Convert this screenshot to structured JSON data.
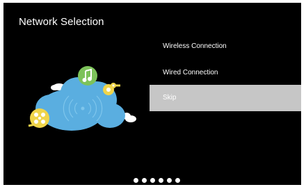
{
  "screen": {
    "title": "Network Selection"
  },
  "menu": {
    "items": [
      {
        "label": "Wireless Connection",
        "selected": false
      },
      {
        "label": "Wired Connection",
        "selected": false
      },
      {
        "label": "Skip",
        "selected": true
      }
    ]
  },
  "pager": {
    "total_pages": 6
  },
  "colors": {
    "background": "#000000",
    "selection": "#c6c6c6",
    "cloud": "#5aaee0",
    "music_badge": "#7dc25a",
    "film_reel": "#f0d54a"
  },
  "icons": [
    "cloud-icon",
    "wifi-signal-icon",
    "music-note-icon",
    "film-reel-icon"
  ]
}
